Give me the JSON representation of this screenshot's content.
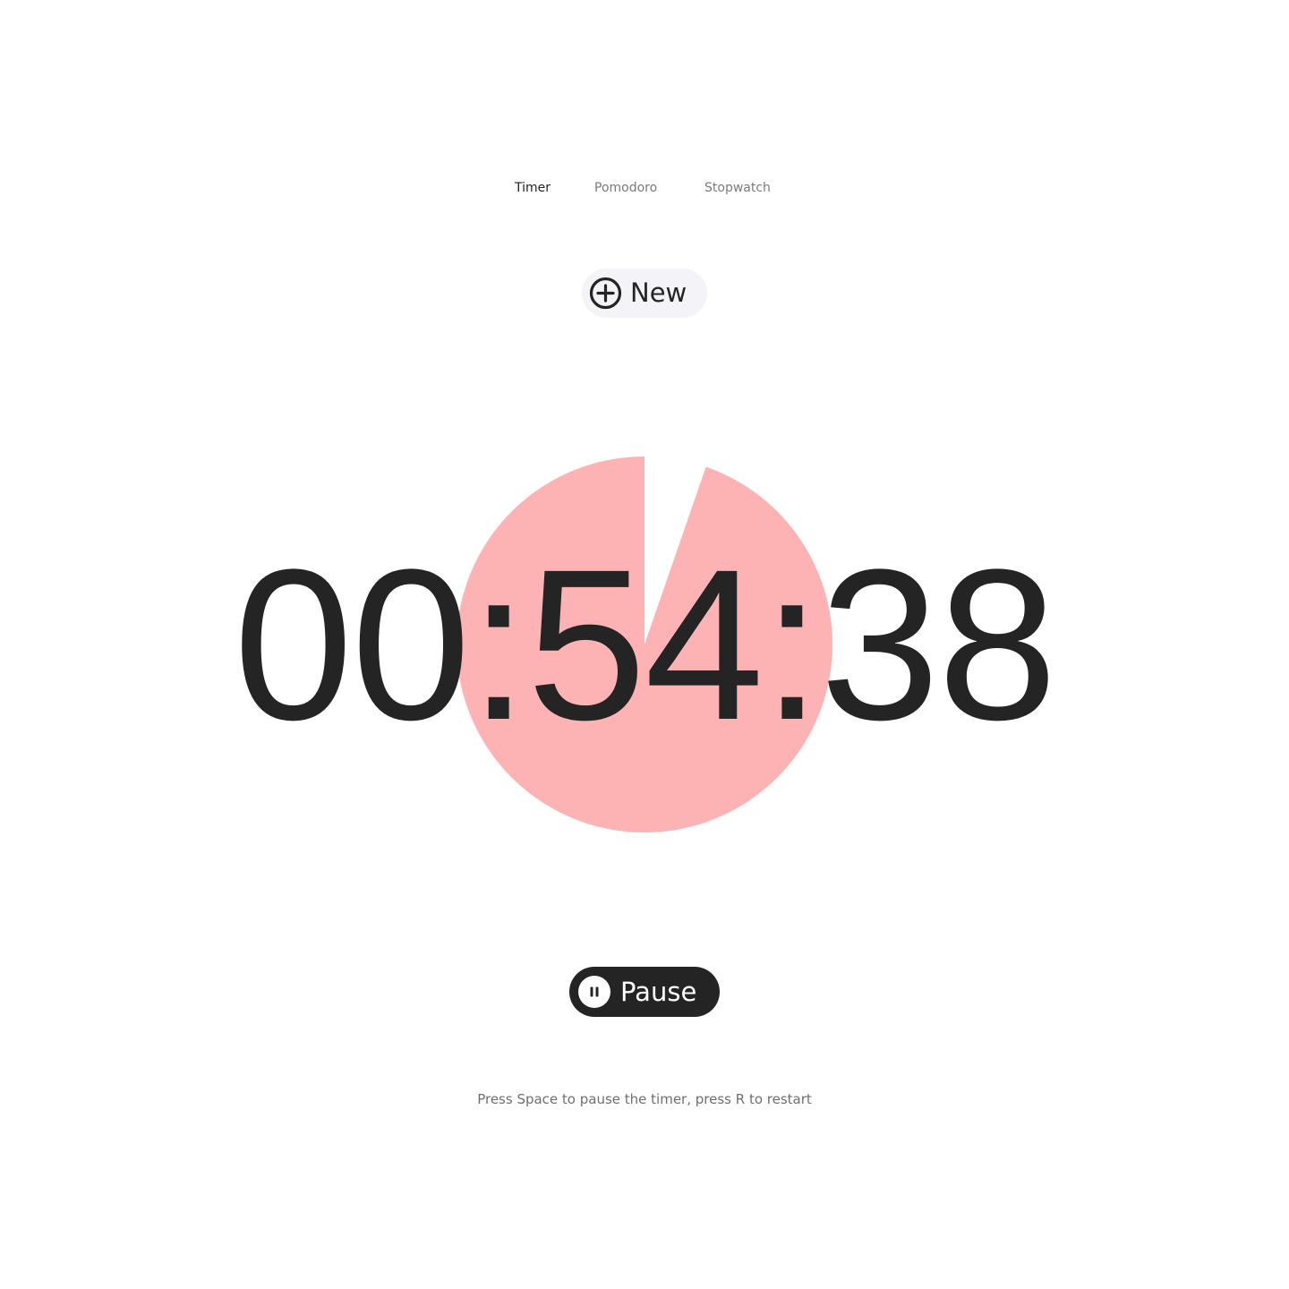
{
  "tabs": [
    {
      "label": "Timer",
      "active": true
    },
    {
      "label": "Pomodoro",
      "active": false
    },
    {
      "label": "Stopwatch",
      "active": false
    }
  ],
  "new_button": {
    "label": "New",
    "icon": "plus-circle-icon"
  },
  "timer": {
    "display": "00:54:38",
    "remaining_fraction": 0.947,
    "pie_color": "#fdb3b3"
  },
  "pause_button": {
    "label": "Pause",
    "icon": "pause-icon"
  },
  "hint": "Press Space to pause the timer, press R to restart",
  "colors": {
    "text": "#242424",
    "muted": "#7a7a7a",
    "button_dark": "#242424",
    "button_light": "#f4f4f8"
  }
}
